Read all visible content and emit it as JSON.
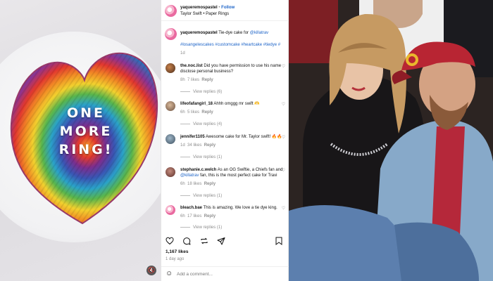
{
  "cake_photo": {
    "cake_text_lines": [
      "ONE",
      "MORE",
      "RING!"
    ],
    "icon": "volume-muted-icon"
  },
  "post": {
    "header": {
      "username": "yaqueremospastel",
      "separator": "•",
      "follow_label": "Follow",
      "subtitle": "Taylor Swift • Paper Rings"
    },
    "caption": {
      "username": "yaqueremospastel",
      "text": "Tie-dye cake for ",
      "mention": "@killatrav",
      "hashtags": "#losangelescakes #customcake #heartcake #tiedye #",
      "time": "1d"
    },
    "comments": [
      {
        "username": "the.noc.list",
        "text_line1": "Did you have permission to use his name",
        "text_line2": "disclose personal business?",
        "time": "8h",
        "likes": "7 likes",
        "reply": "Reply",
        "view_replies": "View replies (6)"
      },
      {
        "username": "lifeofafangirl_18",
        "text_line1": "Ahhh omggg mr swift 🫶",
        "text_line2": "",
        "time": "6h",
        "likes": "5 likes",
        "reply": "Reply",
        "view_replies": "View replies (4)"
      },
      {
        "username": "jennifer1105",
        "text_line1": "Awesome cake for Mr. Taylor swift! 🔥🔥",
        "text_line2": "",
        "time": "1d",
        "likes": "34 likes",
        "reply": "Reply",
        "view_replies": "View replies (1)"
      },
      {
        "username": "stephanie.c.welch",
        "text_line1": "As an OG Swiftie, a Chiefs fan and",
        "text_line2_mention": "@killatrav",
        "text_line2": " fan, this is the most perfect cake for Travi",
        "time": "6h",
        "likes": "18 likes",
        "reply": "Reply",
        "view_replies": "View replies (1)"
      },
      {
        "username": "bleach.bae",
        "text_line1": "This is amazing. We love a tie dye king.",
        "text_line2": "",
        "time": "6h",
        "likes": "17 likes",
        "reply": "Reply",
        "view_replies": "View replies (1)"
      }
    ],
    "actions": {
      "like_icon": "heart-icon",
      "comment_icon": "comment-icon",
      "repost_icon": "repost-icon",
      "share_icon": "share-icon",
      "save_icon": "bookmark-icon"
    },
    "likes_count": "1,167 likes",
    "posted_ago": "1 day ago",
    "add_comment_placeholder": "Add a comment..."
  },
  "colors": {
    "accent_blue": "#1d64c8",
    "grey_text": "#8e8e8e",
    "brand_pink": "#e96aa0"
  }
}
